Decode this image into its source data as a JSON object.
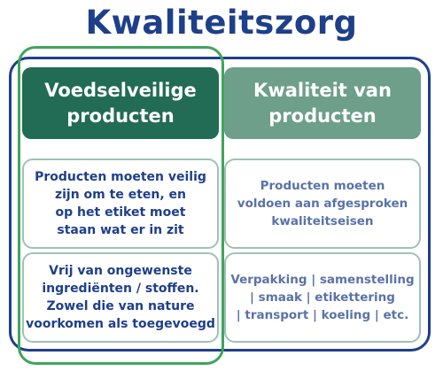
{
  "title": "Kwaliteitszorg",
  "columns": [
    {
      "header": "Voedselveilige\nproducten",
      "cells": [
        "Producten moeten veilig\nzijn om te eten, en\nop het etiket moet\nstaan wat er in zit",
        "Vrij van ongewenste\ningrediënten / stoffen.\nZowel die van nature\nvoorkomen als toegevoegd"
      ]
    },
    {
      "header": "Kwaliteit van\nproducten",
      "cells": [
        "Producten moeten\nvoldoen aan afgesproken\nkwaliteitseisen",
        "Verpakking | samenstelling\n| smaak | etikettering\n| transport | koeling | etc."
      ]
    }
  ],
  "colors": {
    "title": "#1e3f8a",
    "outer_frame": "#1e3f8a",
    "highlight_frame": "#3fa55b",
    "header_left": "#226b55",
    "header_right": "#6d9f8a",
    "cell_border": "#9ec2b3"
  }
}
